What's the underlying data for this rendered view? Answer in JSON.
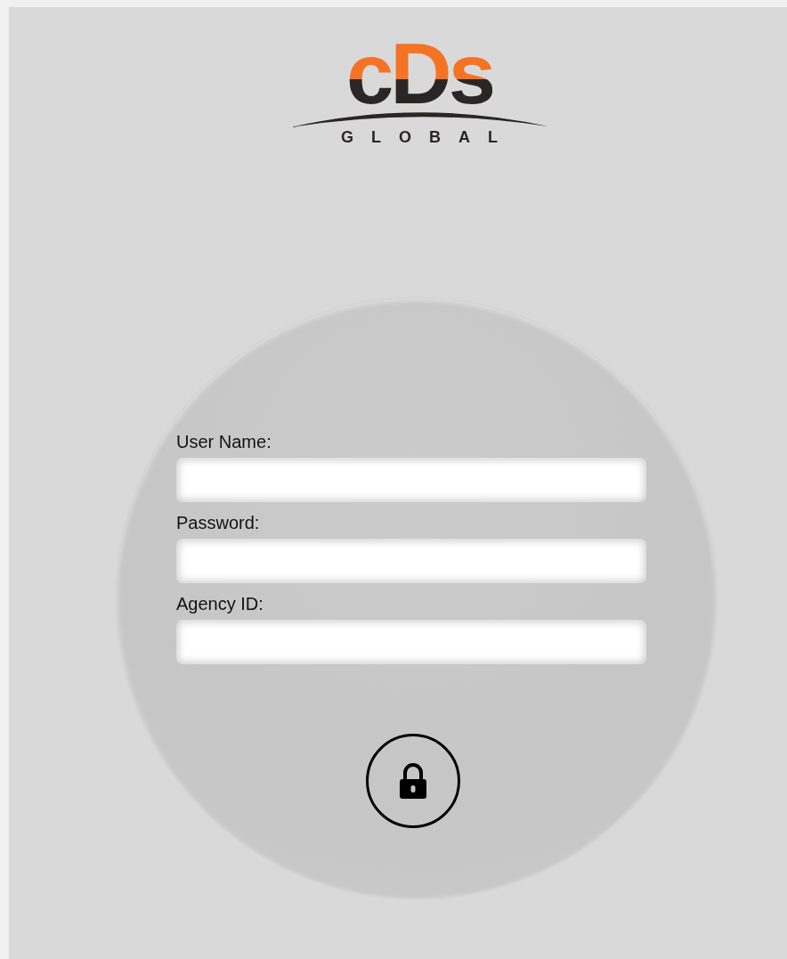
{
  "logo": {
    "mark": "cDs",
    "tagline": "GLOBAL"
  },
  "fields": [
    {
      "label": "User Name:"
    },
    {
      "label": "Password:"
    },
    {
      "label": "Agency ID:"
    }
  ]
}
